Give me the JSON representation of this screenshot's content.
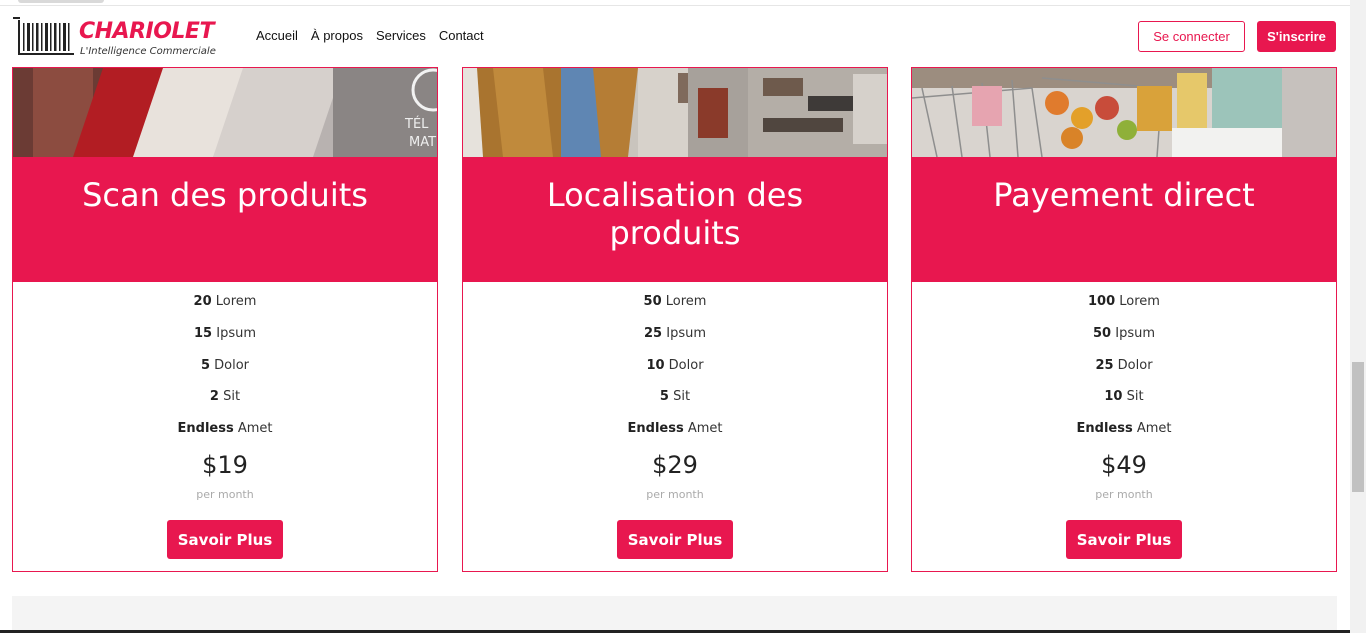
{
  "brand": {
    "name": "CHARIOLET",
    "tagline": "L'Intelligence Commerciale",
    "accent": "#e8174f"
  },
  "nav": {
    "items": [
      "Accueil",
      "À propos",
      "Services",
      "Contact"
    ]
  },
  "auth": {
    "login_label": "Se connecter",
    "signup_label": "S'inscrire"
  },
  "plans": [
    {
      "title": "Scan des produits",
      "features": [
        {
          "value": "20",
          "label": "Lorem"
        },
        {
          "value": "15",
          "label": "Ipsum"
        },
        {
          "value": "5",
          "label": "Dolor"
        },
        {
          "value": "2",
          "label": "Sit"
        },
        {
          "value": "Endless",
          "label": "Amet"
        }
      ],
      "price": "$19",
      "period": "per month",
      "cta": "Savoir Plus",
      "photo_text": "TÉL\nMAT"
    },
    {
      "title": "Localisation des produits",
      "features": [
        {
          "value": "50",
          "label": "Lorem"
        },
        {
          "value": "25",
          "label": "Ipsum"
        },
        {
          "value": "10",
          "label": "Dolor"
        },
        {
          "value": "5",
          "label": "Sit"
        },
        {
          "value": "Endless",
          "label": "Amet"
        }
      ],
      "price": "$29",
      "period": "per month",
      "cta": "Savoir Plus"
    },
    {
      "title": "Payement direct",
      "features": [
        {
          "value": "100",
          "label": "Lorem"
        },
        {
          "value": "50",
          "label": "Ipsum"
        },
        {
          "value": "25",
          "label": "Dolor"
        },
        {
          "value": "10",
          "label": "Sit"
        },
        {
          "value": "Endless",
          "label": "Amet"
        }
      ],
      "price": "$49",
      "period": "per month",
      "cta": "Savoir Plus"
    }
  ]
}
